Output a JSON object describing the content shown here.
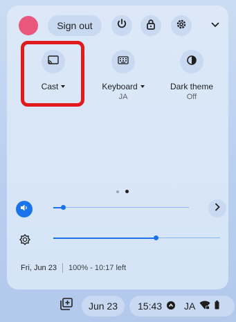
{
  "quick_settings": {
    "sign_out_label": "Sign out",
    "tiles": [
      {
        "label": "Cast",
        "sub": "",
        "icon": "cast-icon"
      },
      {
        "label": "Keyboard",
        "sub": "JA",
        "icon": "keyboard-icon"
      },
      {
        "label": "Dark theme",
        "sub": "Off",
        "icon": "dark-theme-icon"
      }
    ],
    "volume_level": 0.06,
    "brightness_level": 0.61,
    "date_line": "Fri, Jun 23",
    "battery_line": "100% - 10:17 left",
    "page_count": 2,
    "active_page": 2
  },
  "shelf": {
    "date": "Jun 23",
    "time": "15:43",
    "ime": "JA"
  },
  "colors": {
    "accent": "#1a73e8",
    "highlight": "#e11b1b",
    "avatar": "#e9577d"
  }
}
